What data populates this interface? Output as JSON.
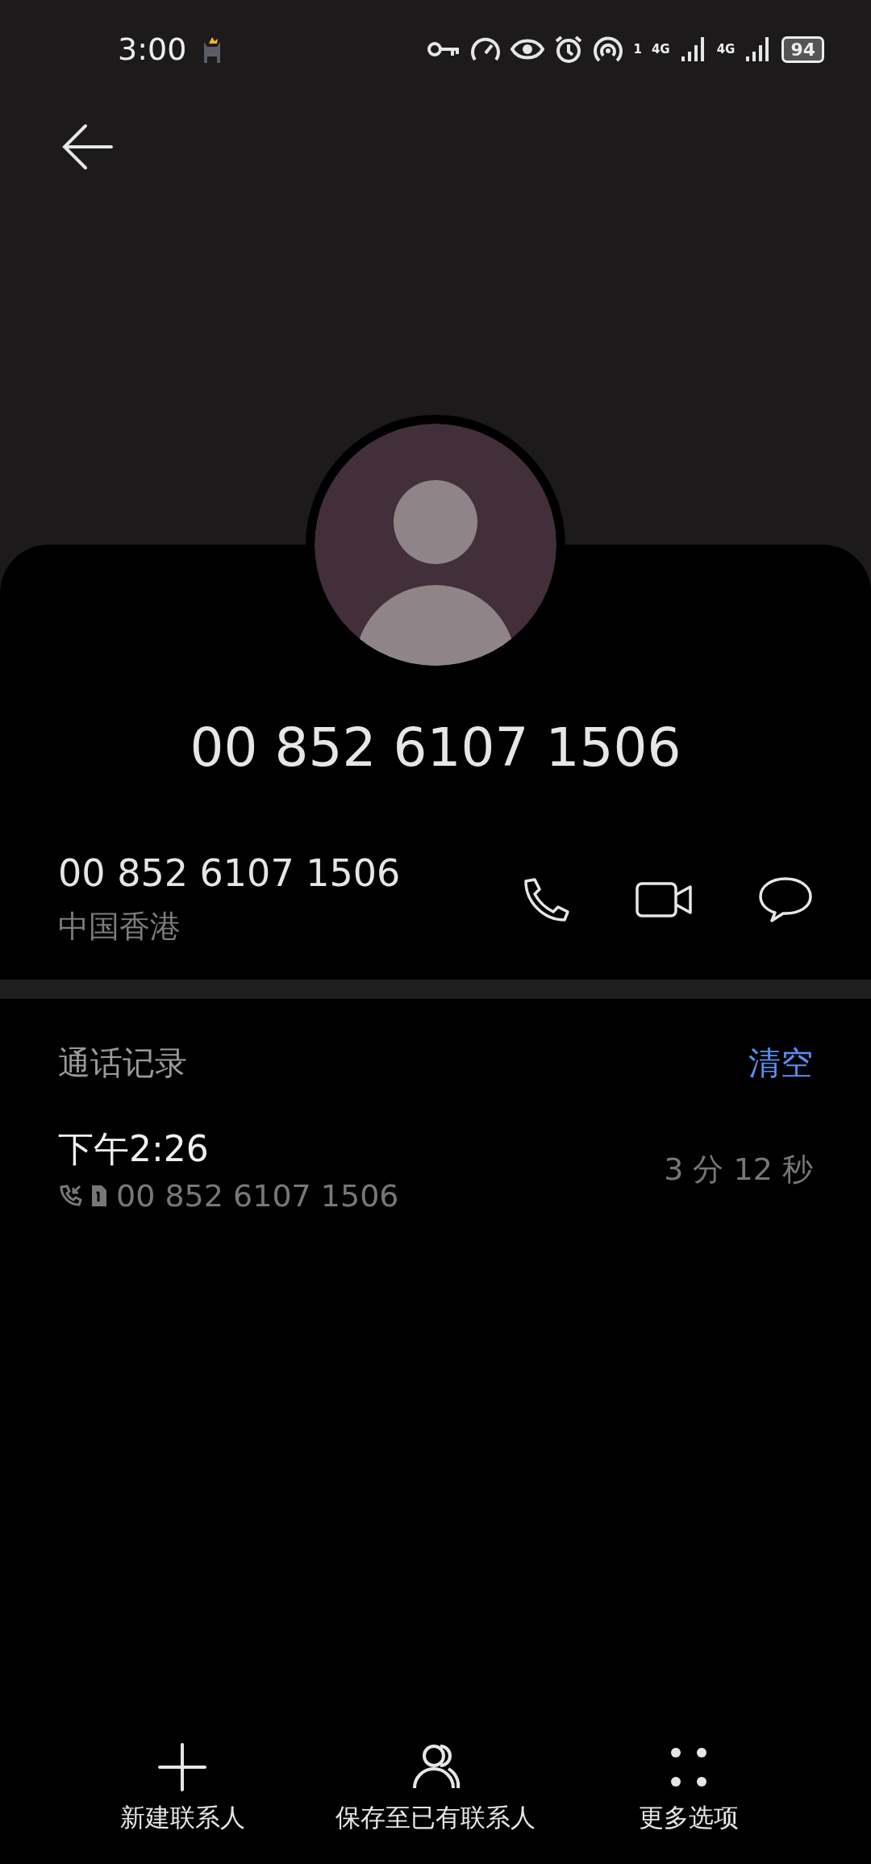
{
  "status_bar": {
    "time": "3:00",
    "hotspot_badge": "1",
    "sim1_network": "4G",
    "sim2_network": "4G",
    "battery": "94"
  },
  "contact": {
    "title": "00 852 6107 1506"
  },
  "number": {
    "value": "00 852 6107 1506",
    "location": "中国香港"
  },
  "call_log": {
    "title": "通话记录",
    "clear": "清空",
    "entries": [
      {
        "time": "下午2:26",
        "number": "00 852 6107 1506",
        "duration": "3 分 12 秒",
        "kind": "incoming"
      }
    ]
  },
  "bottom_actions": [
    {
      "label": "新建联系人",
      "kind": "add"
    },
    {
      "label": "保存至已有联系人",
      "kind": "existing"
    },
    {
      "label": "更多选项",
      "kind": "more"
    }
  ]
}
